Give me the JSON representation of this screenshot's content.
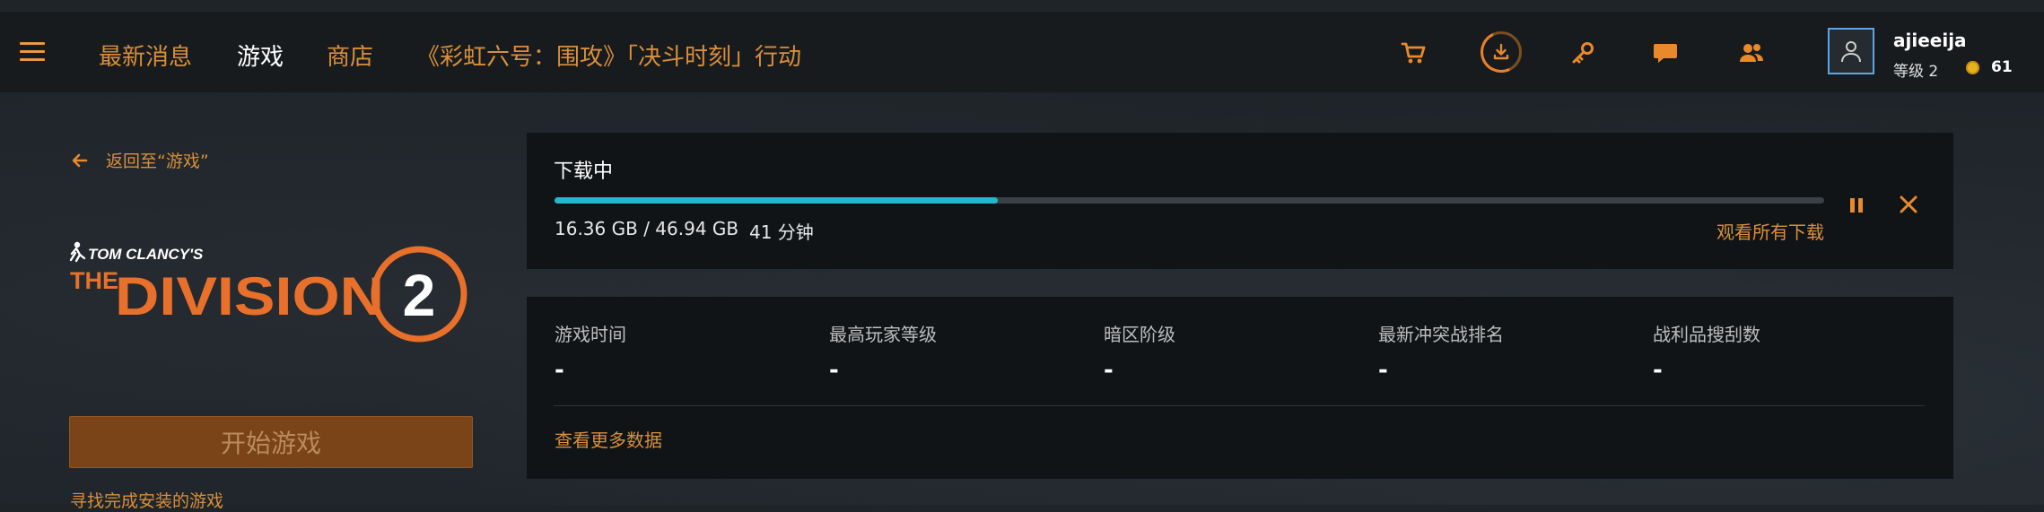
{
  "nav": {
    "items": [
      {
        "label": "最新消息"
      },
      {
        "label": "游戏"
      },
      {
        "label": "商店"
      },
      {
        "label": "《彩虹六号：围攻》「决斗时刻」行动"
      }
    ],
    "active_index": 1
  },
  "icons": {
    "menu": "hamburger-icon",
    "cart": "cart-icon",
    "downloads": "download-icon",
    "key": "key-icon",
    "chat": "chat-icon",
    "friends": "friends-icon",
    "avatar": "user-icon",
    "coin": "coin-icon"
  },
  "user": {
    "name": "ajieeija",
    "level": "等级 2",
    "coins": "61"
  },
  "colors": {
    "accent": "#d98f3b",
    "progress": "#23b8cc",
    "avatar_border": "#5aa6e6",
    "play_button": "#7a4418"
  },
  "game": {
    "back_label": "返回至“游戏”",
    "logo_top": "TOM CLANCY'S",
    "logo_the": "THE",
    "logo_title": "DIVISION",
    "logo_number": "2",
    "play_label": "开始游戏",
    "find_label": "寻找完成安装的游戏"
  },
  "download": {
    "title": "下载中",
    "progress_fraction": 0.349,
    "size_text": "16.36 GB / 46.94 GB",
    "time_left": "41 分钟",
    "view_all": "观看所有下载"
  },
  "stats": {
    "items": [
      {
        "label": "游戏时间",
        "value": "-"
      },
      {
        "label": "最高玩家等级",
        "value": "-"
      },
      {
        "label": "暗区阶级",
        "value": "-"
      },
      {
        "label": "最新冲突战排名",
        "value": "-"
      },
      {
        "label": "战利品搜刮数",
        "value": "-"
      }
    ],
    "more_label": "查看更多数据"
  }
}
